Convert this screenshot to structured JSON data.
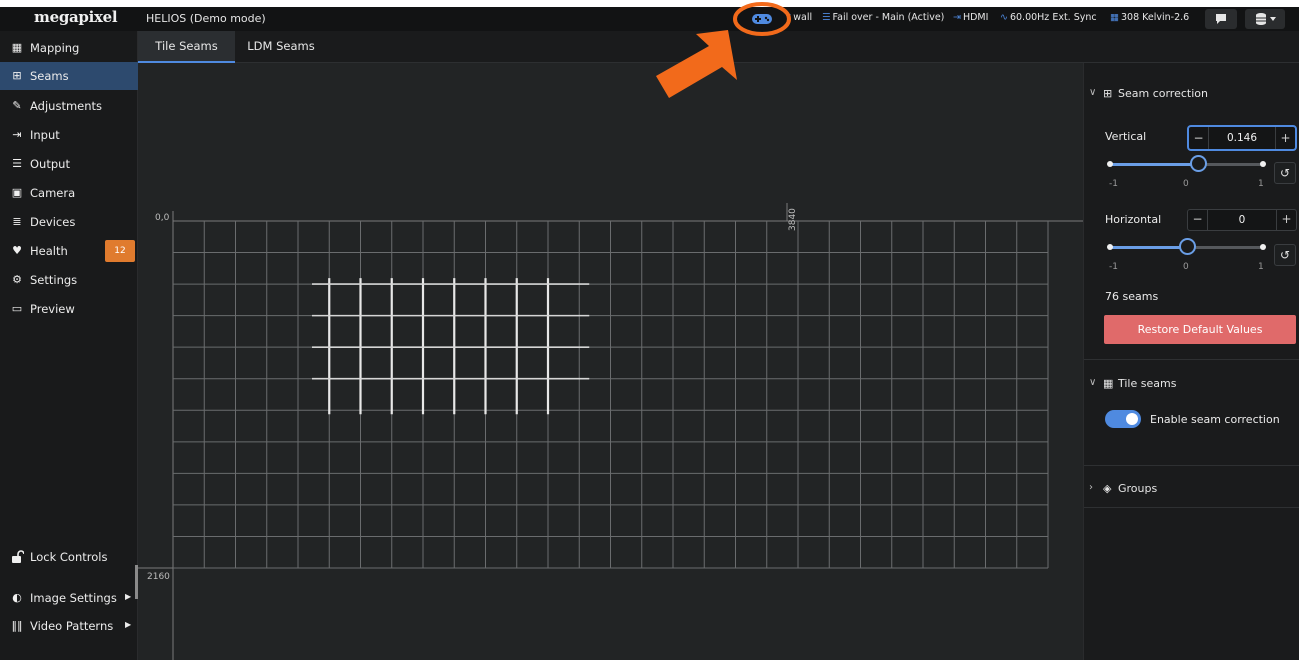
{
  "app": {
    "logo": "megapixel",
    "title": "HELIOS (Demo mode)"
  },
  "status_bar": {
    "wall": "wall",
    "failover": "Fail over - Main (Active)",
    "input": "HDMI",
    "sync": "60.00Hz Ext. Sync",
    "color": "308 Kelvin-2.6"
  },
  "tabs": [
    {
      "label": "Tile Seams",
      "active": true
    },
    {
      "label": "LDM Seams",
      "active": false
    }
  ],
  "sidebar": {
    "items": [
      {
        "label": "Mapping",
        "icon": "table-icon",
        "glyph": "▦"
      },
      {
        "label": "Seams",
        "icon": "seams-icon",
        "glyph": "⊞",
        "active": true
      },
      {
        "label": "Adjustments",
        "icon": "brush-icon",
        "glyph": "✎"
      },
      {
        "label": "Input",
        "icon": "input-icon",
        "glyph": "⇥"
      },
      {
        "label": "Output",
        "icon": "sliders-icon",
        "glyph": "☰"
      },
      {
        "label": "Camera",
        "icon": "film-icon",
        "glyph": "▣"
      },
      {
        "label": "Devices",
        "icon": "list-icon",
        "glyph": "≣"
      },
      {
        "label": "Health",
        "icon": "heart-pulse-icon",
        "glyph": "♥",
        "badge": "12"
      },
      {
        "label": "Settings",
        "icon": "gears-icon",
        "glyph": "⚙"
      },
      {
        "label": "Preview",
        "icon": "monitor-icon",
        "glyph": "▭"
      }
    ],
    "lock_controls": "Lock Controls",
    "image_settings": "Image Settings",
    "video_patterns": "Video Patterns"
  },
  "canvas": {
    "origin_label": "0,0",
    "width_label": "3840",
    "height_label": "2160"
  },
  "panel": {
    "seam_correction": {
      "title": "Seam correction",
      "vertical_label": "Vertical",
      "vertical_value": "0.146",
      "vertical_fraction": 0.573,
      "horizontal_label": "Horizontal",
      "horizontal_value": "0",
      "horizontal_fraction": 0.5,
      "min_label": "-1",
      "mid_label": "0",
      "max_label": "1",
      "seam_count": "76 seams",
      "restore_label": "Restore Default Values"
    },
    "tile_seams": {
      "title": "Tile seams",
      "toggle_label": "Enable seam correction",
      "enabled": true
    },
    "groups": {
      "title": "Groups"
    }
  },
  "colors": {
    "accent": "#4f8ae0",
    "badge": "#e07b2e",
    "restore": "#e06a6a",
    "annotation": "#f26a1b"
  }
}
